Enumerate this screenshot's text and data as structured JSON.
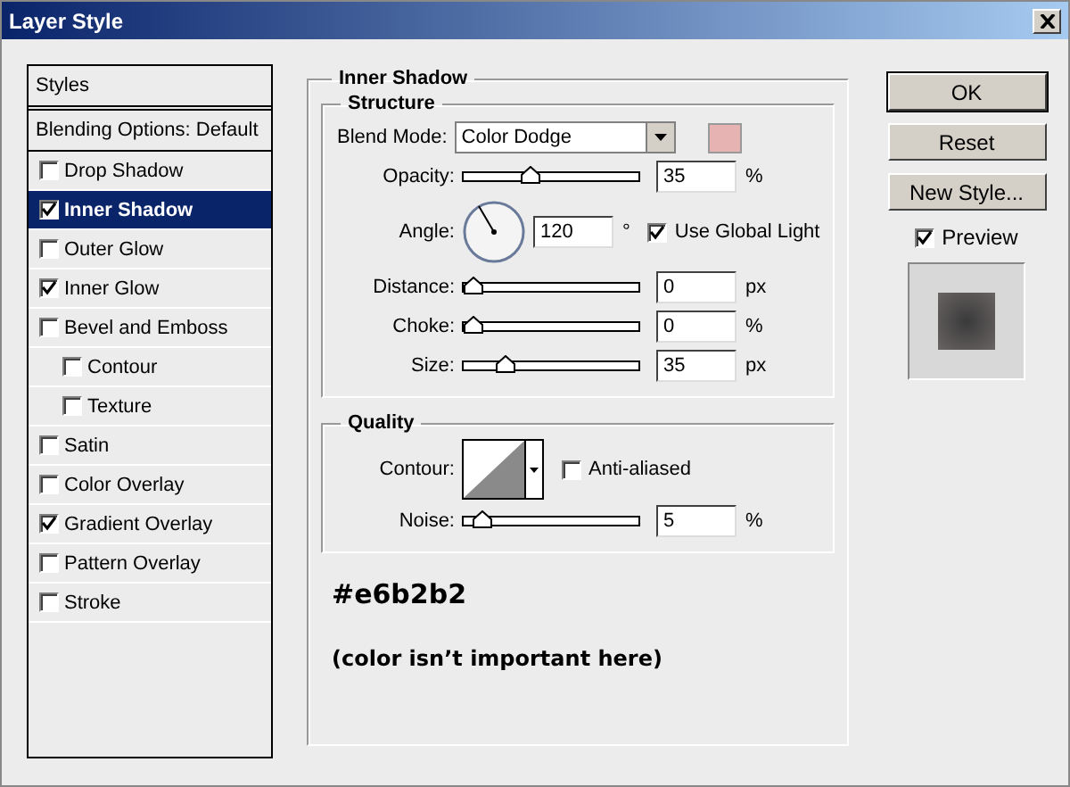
{
  "window": {
    "title": "Layer Style"
  },
  "styles_panel": {
    "header": "Styles",
    "blending": "Blending Options: Default",
    "items": [
      {
        "label": "Drop Shadow",
        "checked": false,
        "selected": false
      },
      {
        "label": "Inner Shadow",
        "checked": true,
        "selected": true
      },
      {
        "label": "Outer Glow",
        "checked": false,
        "selected": false
      },
      {
        "label": "Inner Glow",
        "checked": true,
        "selected": false
      },
      {
        "label": "Bevel and Emboss",
        "checked": false,
        "selected": false,
        "children": [
          {
            "label": "Contour",
            "checked": false,
            "selected": false
          },
          {
            "label": "Texture",
            "checked": false,
            "selected": false
          }
        ]
      },
      {
        "label": "Satin",
        "checked": false,
        "selected": false
      },
      {
        "label": "Color Overlay",
        "checked": false,
        "selected": false
      },
      {
        "label": "Gradient Overlay",
        "checked": true,
        "selected": false
      },
      {
        "label": "Pattern Overlay",
        "checked": false,
        "selected": false
      },
      {
        "label": "Stroke",
        "checked": false,
        "selected": false
      }
    ]
  },
  "inner_shadow": {
    "title": "Inner Shadow",
    "structure": {
      "title": "Structure",
      "blend_mode": {
        "label": "Blend Mode:",
        "value": "Color Dodge",
        "color": "#e6b2b2"
      },
      "opacity": {
        "label": "Opacity:",
        "level": 0.35,
        "value": "35",
        "unit": "%"
      },
      "angle": {
        "label": "Angle:",
        "value": "120",
        "unit": "°",
        "use_global_light": {
          "label": "Use Global Light",
          "checked": true
        }
      },
      "sliders": [
        {
          "label": "Distance:",
          "level": 0,
          "value": "0",
          "unit": "px"
        },
        {
          "label": "Choke:",
          "level": 0,
          "value": "0",
          "unit": "%"
        },
        {
          "label": "Size:",
          "level": 0.2,
          "value": "35",
          "unit": "px"
        }
      ]
    },
    "quality": {
      "title": "Quality",
      "contour_label": "Contour:",
      "anti_aliased": {
        "label": "Anti-aliased",
        "checked": false
      },
      "noise": {
        "label": "Noise:",
        "level": 0.05,
        "value": "5",
        "unit": "%"
      }
    },
    "note_color": "#e6b2b2",
    "note_text": "(color isn’t important here)"
  },
  "buttons": [
    "OK",
    "Reset",
    "New Style..."
  ],
  "preview": {
    "label": "Preview",
    "checked": true
  }
}
